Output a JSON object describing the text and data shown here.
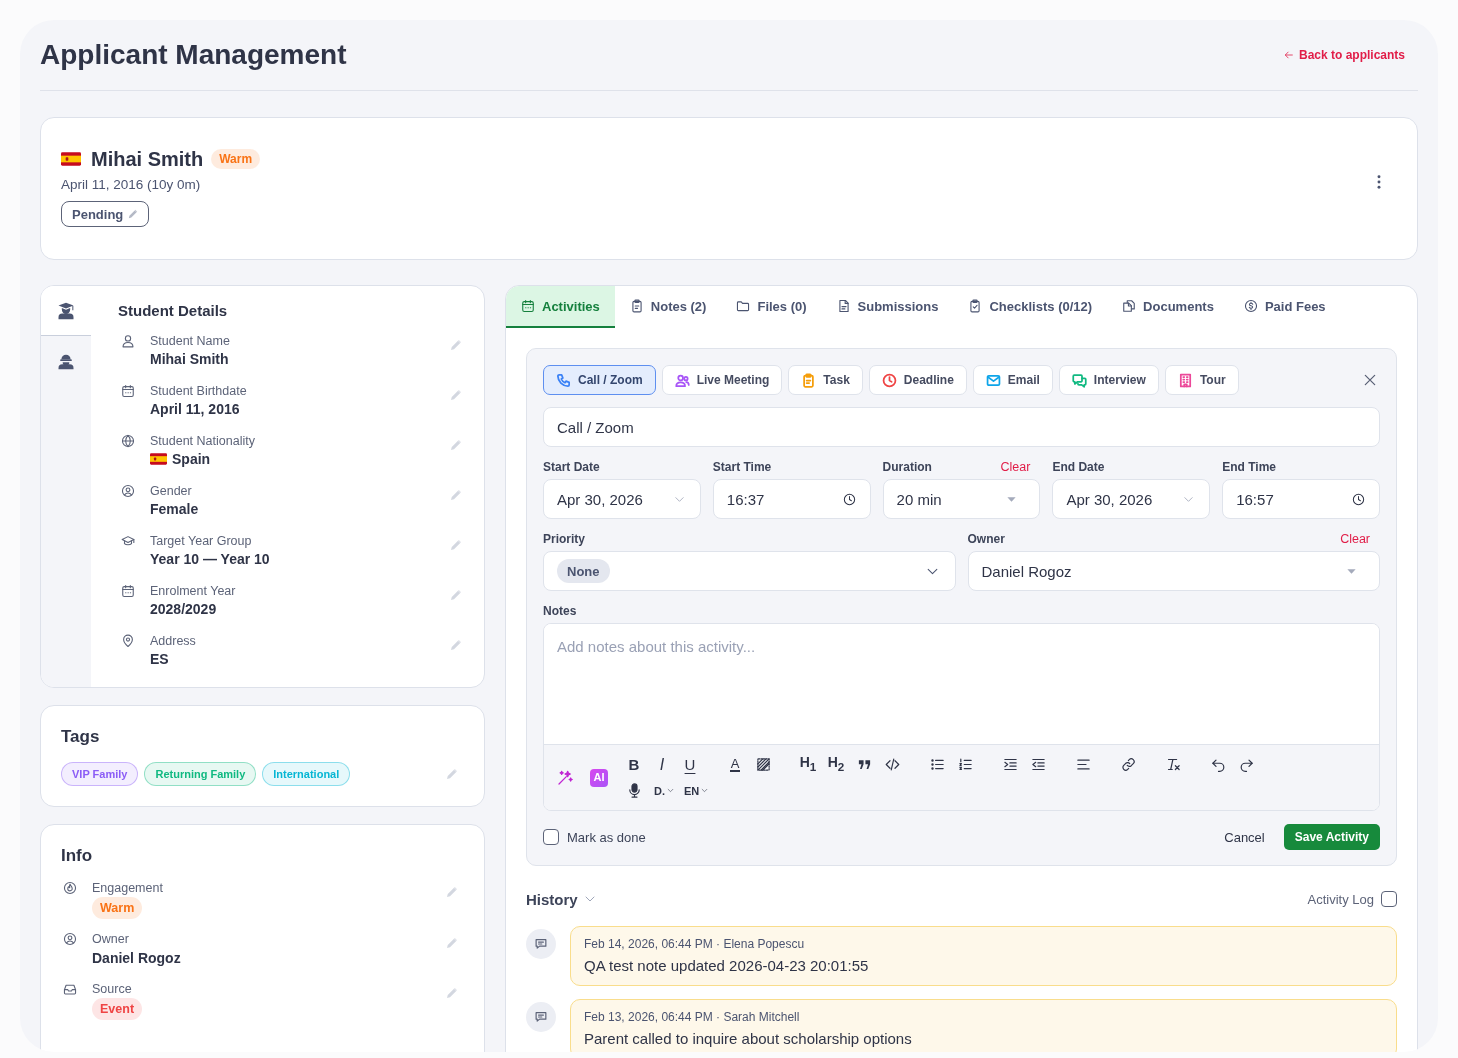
{
  "header": {
    "title": "Applicant Management",
    "back_link": "Back to applicants"
  },
  "profile": {
    "name": "Mihai Smith",
    "engagement": {
      "label": "Warm",
      "color": "#f97316"
    },
    "birth_line": "April 11, 2016 (10y 0m)",
    "status": "Pending"
  },
  "student_details": {
    "side_tabs": [
      {
        "selected": true
      },
      {
        "selected": false
      }
    ],
    "title": "Student Details",
    "fields": [
      {
        "kind": "text",
        "label": "Student Name",
        "value": "Mihai Smith"
      },
      {
        "kind": "text",
        "label": "Student Birthdate",
        "value": "April 11, 2016"
      },
      {
        "kind": "country",
        "label": "Student Nationality",
        "value": "Spain"
      },
      {
        "kind": "text",
        "label": "Gender",
        "value": "Female"
      },
      {
        "kind": "text",
        "label": "Target Year Group",
        "value": "Year 10 — Year 10"
      },
      {
        "kind": "text",
        "label": "Enrolment Year",
        "value": "2028/2029"
      },
      {
        "kind": "text",
        "label": "Address",
        "value": "ES"
      }
    ]
  },
  "tags": {
    "title": "Tags",
    "items": [
      {
        "label": "VIP Family",
        "color": "#8b5cf6"
      },
      {
        "label": "Returning Family",
        "color": "#10b981"
      },
      {
        "label": "International",
        "color": "#06b6d4"
      }
    ]
  },
  "info": {
    "title": "Info",
    "fields": [
      {
        "kind": "badge",
        "label": "Engagement",
        "value": "Warm",
        "color": "#f97316"
      },
      {
        "kind": "text",
        "label": "Owner",
        "value": "Daniel Rogoz"
      },
      {
        "kind": "badge",
        "label": "Source",
        "value": "Event",
        "color": "#ef4444"
      }
    ]
  },
  "tabs": [
    {
      "label": "Activities",
      "selected": true
    },
    {
      "label": "Notes (2)",
      "selected": false
    },
    {
      "label": "Files (0)",
      "selected": false
    },
    {
      "label": "Submissions",
      "selected": false
    },
    {
      "label": "Checklists (0/12)",
      "selected": false
    },
    {
      "label": "Documents",
      "selected": false
    },
    {
      "label": "Paid Fees",
      "selected": false
    }
  ],
  "activity_form": {
    "types": [
      {
        "label": "Call / Zoom",
        "selected": true,
        "color": "#3b82f6"
      },
      {
        "label": "Live Meeting",
        "selected": false,
        "color": "#a855f7"
      },
      {
        "label": "Task",
        "selected": false,
        "color": "#f59e0b"
      },
      {
        "label": "Deadline",
        "selected": false,
        "color": "#ef4444"
      },
      {
        "label": "Email",
        "selected": false,
        "color": "#0ea5e9"
      },
      {
        "label": "Interview",
        "selected": false,
        "color": "#10b981"
      },
      {
        "label": "Tour",
        "selected": false,
        "color": "#ec4899"
      }
    ],
    "title": "Call / Zoom",
    "schedule": [
      {
        "kind": "date",
        "label": "Start Date",
        "value": "Apr 30, 2026"
      },
      {
        "kind": "time",
        "label": "Start Time",
        "value": "16:37"
      },
      {
        "kind": "select",
        "label": "Duration",
        "value": "20 min",
        "action": "Clear"
      },
      {
        "kind": "date",
        "label": "End Date",
        "value": "Apr 30, 2026"
      },
      {
        "kind": "time",
        "label": "End Time",
        "value": "16:57"
      }
    ],
    "priority": {
      "label": "Priority",
      "value": "None"
    },
    "owner": {
      "label": "Owner",
      "value": "Daniel Rogoz",
      "action": "Clear"
    },
    "notes": {
      "label": "Notes",
      "placeholder": "Add notes about this activity..."
    },
    "toolbar": {
      "ai": "AI",
      "groups": [
        [
          {
            "kind": "bold",
            "label": "B"
          },
          {
            "kind": "italic",
            "label": "I"
          },
          {
            "kind": "underline",
            "label": "U"
          }
        ],
        [
          {
            "kind": "text-color",
            "label": "A"
          },
          {
            "kind": "highlight"
          }
        ],
        [
          {
            "kind": "heading",
            "label": "H$_{1}$"
          },
          {
            "kind": "heading",
            "label": "H$_{2}$"
          },
          {
            "kind": "quote"
          },
          {
            "kind": "code"
          }
        ],
        [
          {
            "kind": "bullet-list"
          },
          {
            "kind": "numbered-list"
          }
        ],
        [
          {
            "kind": "indent"
          },
          {
            "kind": "outdent"
          }
        ],
        [
          {
            "kind": "align"
          }
        ],
        [
          {
            "kind": "link"
          }
        ],
        [
          {
            "kind": "clear-format"
          }
        ],
        [
          {
            "kind": "undo"
          },
          {
            "kind": "redo"
          }
        ]
      ],
      "extras": [
        {
          "kind": "mic"
        },
        {
          "kind": "dropdown",
          "label": "D."
        },
        {
          "kind": "dropdown",
          "label": "EN"
        }
      ]
    },
    "mark_done": {
      "label": "Mark as done",
      "checked": false
    },
    "cancel": "Cancel",
    "save": "Save Activity"
  },
  "history": {
    "title": "History",
    "expanded": true,
    "activity_log": {
      "label": "Activity Log",
      "checked": false
    },
    "entries": [
      {
        "meta": "Feb 14, 2026, 06:44 PM · Elena Popescu",
        "text": "QA test note updated 2026-04-23 20:01:55"
      },
      {
        "meta": "Feb 13, 2026, 06:44 PM · Sarah Mitchell",
        "text": "Parent called to inquire about scholarship options"
      }
    ]
  }
}
